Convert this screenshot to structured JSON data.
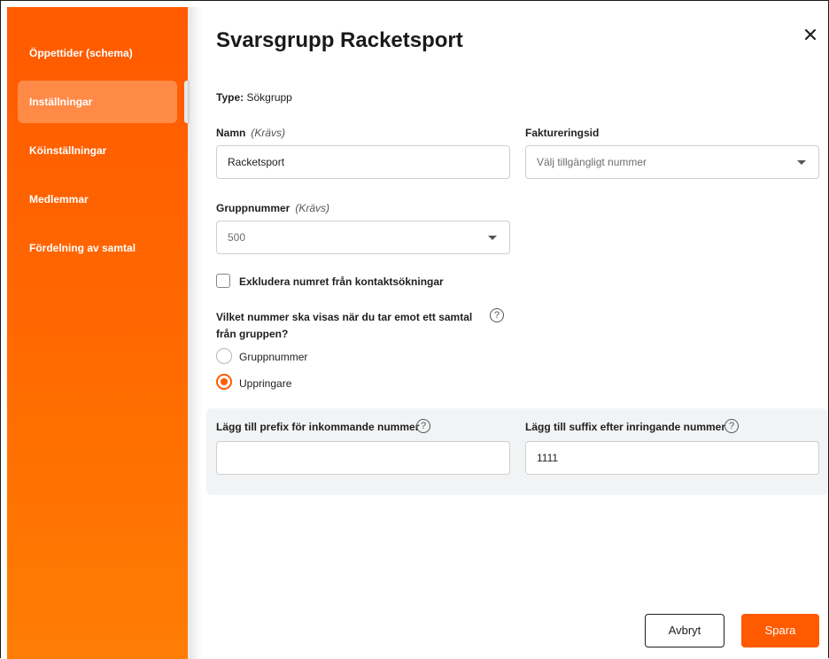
{
  "sidebar": {
    "items": [
      {
        "label": "Öppettider (schema)"
      },
      {
        "label": "Inställningar",
        "active": true
      },
      {
        "label": "Köinställningar"
      },
      {
        "label": "Medlemmar"
      },
      {
        "label": "Fördelning av samtal"
      }
    ]
  },
  "dialog": {
    "title": "Svarsgrupp Racketsport",
    "close_icon": "close-icon",
    "type_label": "Type",
    "type_sep": ":",
    "type_value": "Sökgrupp",
    "name_label": "Namn",
    "name_required": "(Krävs)",
    "name_value": "Racketsport",
    "billing_label": "Faktureringsid",
    "billing_placeholder": "Välj tillgängligt nummer",
    "group_number_label": "Gruppnummer",
    "group_number_required": "(Krävs)",
    "group_number_value": "500",
    "exclude_label": "Exkludera numret från kontaktsökningar",
    "exclude_checked": false,
    "display_question_line1": "Vilket nummer ska visas när du tar emot ett samtal",
    "display_question_line2": "från gruppen?",
    "help_glyph": "?",
    "radio_options": [
      {
        "label": "Gruppnummer",
        "selected": false
      },
      {
        "label": "Uppringare",
        "selected": true
      }
    ],
    "prefix_label": "Lägg till prefix för inkommande nummer",
    "prefix_value": "",
    "suffix_label": "Lägg till suffix efter inringande nummer",
    "suffix_value": "1111",
    "cancel_label": "Avbryt",
    "save_label": "Spara"
  },
  "colors": {
    "accent": "#ff5a00",
    "sidebar_start": "#ff5a00",
    "sidebar_end": "#ff7d05",
    "text": "#1f1f1f",
    "grey_box": "#f2f3f5"
  }
}
